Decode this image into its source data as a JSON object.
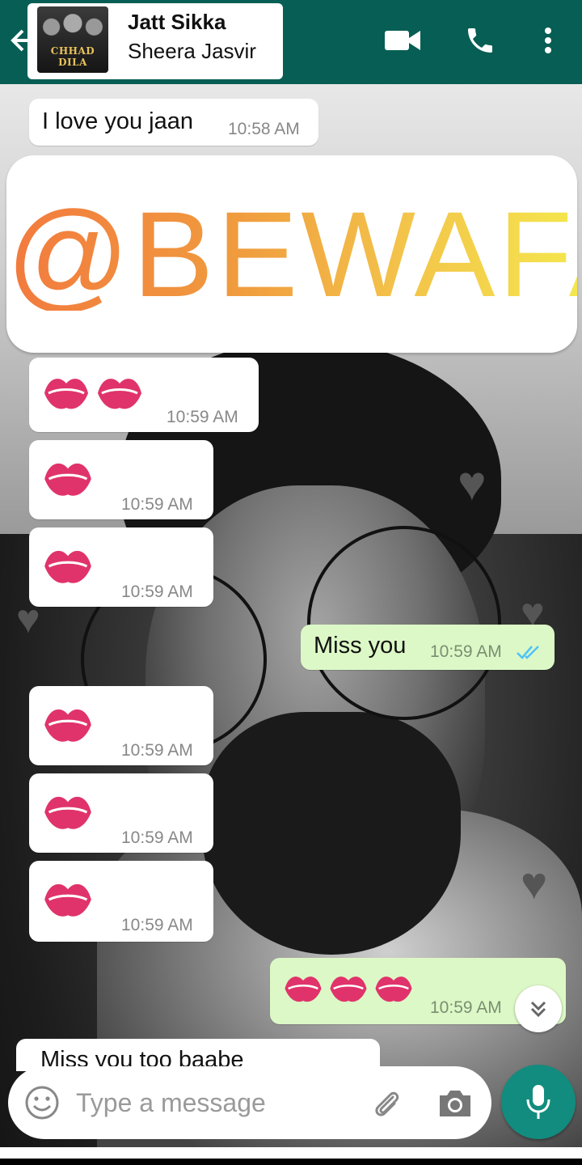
{
  "header": {
    "song_title": "Jatt Sikka",
    "song_artist": "Sheera Jasvir",
    "album_logo_text": "CHHAD DILA",
    "color": "#075e54",
    "icons": [
      "back-arrow-icon",
      "video-call-icon",
      "phone-icon",
      "more-vert-icon"
    ]
  },
  "banner": {
    "text": "@BEWAFA",
    "gradient": [
      "#f27a3e",
      "#f4e64d"
    ]
  },
  "messages": [
    {
      "dir": "in",
      "text": "I love you jaan",
      "time": "10:58 AM"
    },
    {
      "dir": "in",
      "emoji": "kiss-mark",
      "count": 2,
      "time": "10:59 AM"
    },
    {
      "dir": "in",
      "emoji": "kiss-mark",
      "count": 1,
      "time": "10:59 AM"
    },
    {
      "dir": "in",
      "emoji": "kiss-mark",
      "count": 1,
      "time": "10:59 AM"
    },
    {
      "dir": "out",
      "text": "Miss you",
      "time": "10:59 AM",
      "status": "read"
    },
    {
      "dir": "in",
      "emoji": "kiss-mark",
      "count": 1,
      "time": "10:59 AM"
    },
    {
      "dir": "in",
      "emoji": "kiss-mark",
      "count": 1,
      "time": "10:59 AM"
    },
    {
      "dir": "in",
      "emoji": "kiss-mark",
      "count": 1,
      "time": "10:59 AM"
    },
    {
      "dir": "out",
      "emoji": "kiss-mark",
      "count": 3,
      "time": "10:59 AM"
    },
    {
      "dir": "in",
      "text": "Miss you too baabe",
      "time": ""
    }
  ],
  "composer": {
    "placeholder": "Type a message"
  },
  "colors": {
    "incoming": "#ffffff",
    "outgoing": "#dcf8c6",
    "mic": "#128c7e",
    "read_tick": "#4fc3f7"
  }
}
